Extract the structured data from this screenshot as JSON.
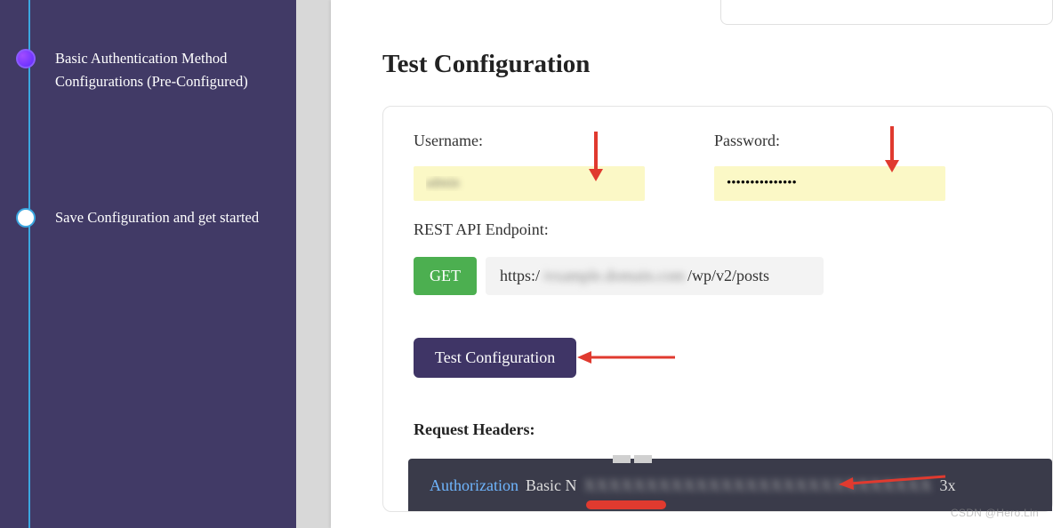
{
  "sidebar": {
    "steps": [
      {
        "label": "Basic Authentication Method Configurations (Pre-Configured)"
      },
      {
        "label": "Save Configuration and get started"
      }
    ]
  },
  "main": {
    "title": "Test Configuration",
    "username_label": "Username:",
    "username_value": "admin",
    "password_label": "Password:",
    "password_value": "•••••••••••••••",
    "rest_label": "REST API Endpoint:",
    "method": "GET",
    "endpoint_prefix": "https:/",
    "endpoint_hidden": "/example.domain.com",
    "endpoint_suffix": "/wp/v2/posts",
    "test_button": "Test Configuration",
    "req_headers_label": "Request Headers:",
    "auth_header_key": "Authorization",
    "auth_header_prefix": "Basic N",
    "auth_header_hidden": "XXXXXXXXXXXXXXXXXXXXXXXXXXXX",
    "auth_header_suffix": "3x"
  },
  "watermark": "CSDN @Hero.Lin"
}
